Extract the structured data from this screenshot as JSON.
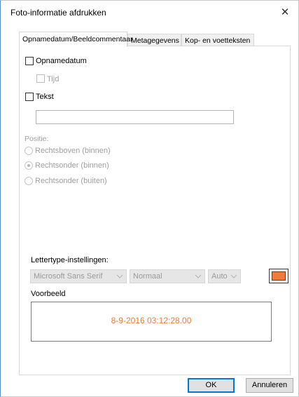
{
  "window": {
    "title": "Foto-informatie afdrukken",
    "close_glyph": "✕"
  },
  "tabs": [
    {
      "label": "Opnamedatum/Beeldcommentaar",
      "active": true
    },
    {
      "label": "Metagegevens",
      "active": false
    },
    {
      "label": "Kop- en voetteksten",
      "active": false
    }
  ],
  "options": {
    "opnamedatum_label": "Opnamedatum",
    "opnamedatum_checked": false,
    "tijd_label": "Tijd",
    "tijd_checked": false,
    "tijd_enabled": false,
    "tekst_label": "Tekst",
    "tekst_checked": false,
    "tekst_value": ""
  },
  "position": {
    "label": "Positie:",
    "choices": [
      {
        "label": "Rechtsboven (binnen)",
        "selected": false
      },
      {
        "label": "Rechtsonder (binnen)",
        "selected": true
      },
      {
        "label": "Rechtsonder (buiten)",
        "selected": false
      }
    ]
  },
  "font_settings": {
    "label": "Lettertype-instellingen:",
    "font_family": "Microsoft Sans Serif",
    "font_style": "Normaal",
    "font_size": "Auto",
    "color": "#f07a3a"
  },
  "preview": {
    "label": "Voorbeeld",
    "sample_text": "8-9-2016 03:12:28.00"
  },
  "buttons": {
    "ok_label": "OK",
    "cancel_label": "Annuleren"
  }
}
